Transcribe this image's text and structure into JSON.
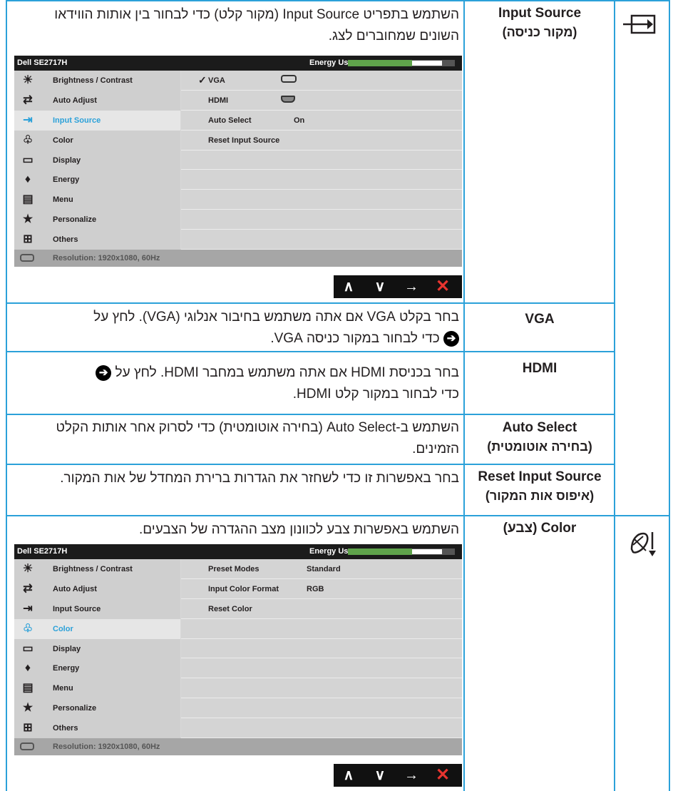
{
  "rows": {
    "input_source": {
      "label_en": "Input Source",
      "label_he": "(מקור כניסה)",
      "desc": "השתמש בתפריט Input Source (מקור קלט) כדי לבחור בין אותות הווידאו השונים שמחוברים לצג."
    },
    "vga": {
      "label": "VGA",
      "desc_a": "בחר בקלט VGA אם אתה משתמש בחיבור אנלוגי (VGA). לחץ על",
      "desc_b": "כדי לבחור במקור כניסה VGA."
    },
    "hdmi": {
      "label": "HDMI",
      "desc_a": "בחר בכניסת HDMI אם אתה משתמש במחבר HDMI. לחץ על",
      "desc_b": "כדי לבחור במקור קלט HDMI."
    },
    "auto_select": {
      "label_en": "Auto Select",
      "label_he": "(בחירה אוטומטית)",
      "desc": "השתמש ב-Auto Select (בחירה אוטומטית) כדי לסרוק אחר אותות הקלט הזמינים."
    },
    "reset_input": {
      "label_en": "Reset Input Source",
      "label_he": "(איפוס אות המקור)",
      "desc": "בחר באפשרות זו כדי לשחזר את הגדרות ברירת המחדל של אות המקור."
    },
    "color": {
      "label": "Color (צבע)",
      "desc": "השתמש באפשרות צבע לכוונון מצב ההגדרה של הצבעים."
    }
  },
  "arrow_glyph": "➔",
  "osd": {
    "model": "Dell SE2717H",
    "energy_label": "Energy Use",
    "energy_level": 0.6,
    "menu": [
      {
        "label": "Brightness / Contrast",
        "icon": "sun-icon",
        "glyph": "☀"
      },
      {
        "label": "Auto Adjust",
        "icon": "auto-adjust-icon",
        "glyph": "⇄"
      },
      {
        "label": "Input Source",
        "icon": "input-source-icon",
        "glyph": "⇥"
      },
      {
        "label": "Color",
        "icon": "color-icon",
        "glyph": "♧"
      },
      {
        "label": "Display",
        "icon": "display-icon",
        "glyph": "▭"
      },
      {
        "label": "Energy",
        "icon": "energy-icon",
        "glyph": "♦"
      },
      {
        "label": "Menu",
        "icon": "menu-icon",
        "glyph": "▤"
      },
      {
        "label": "Personalize",
        "icon": "star-icon",
        "glyph": "★"
      },
      {
        "label": "Others",
        "icon": "others-icon",
        "glyph": "⊞"
      }
    ],
    "resolution": "Resolution: 1920x1080, 60Hz",
    "input_sub": [
      {
        "key": "VGA",
        "check": "✓"
      },
      {
        "key": "HDMI"
      },
      {
        "key": "Auto Select",
        "value": "On"
      },
      {
        "key": "Reset Input Source"
      }
    ],
    "color_sub": [
      {
        "key": "Preset Modes",
        "value": "Standard"
      },
      {
        "key": "Input Color Format",
        "value": "RGB"
      },
      {
        "key": "Reset Color"
      }
    ],
    "nav": [
      "∧",
      "∨",
      "→",
      "✕"
    ]
  }
}
